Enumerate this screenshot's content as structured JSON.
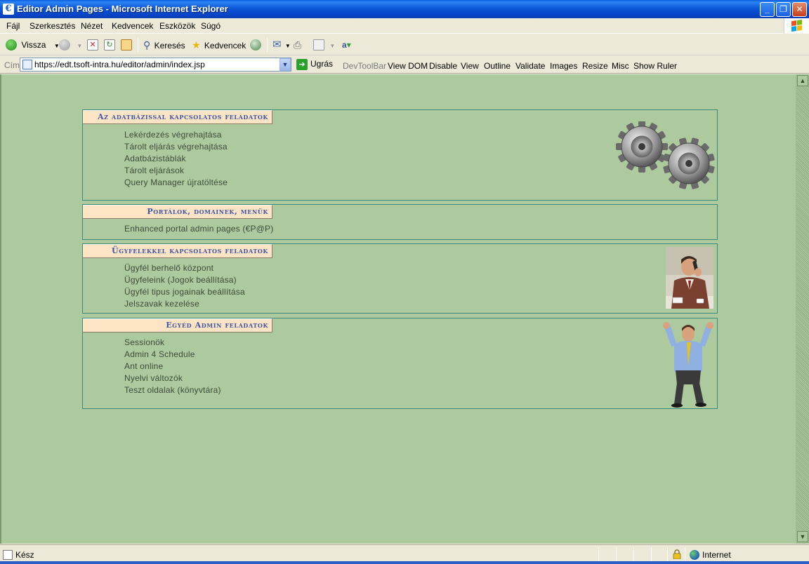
{
  "window": {
    "title": "Editor Admin Pages - Microsoft Internet Explorer",
    "app_icon_glyph": "€"
  },
  "menu": [
    "Fájl",
    "Szerkesztés",
    "Nézet",
    "Kedvencek",
    "Eszközök",
    "Súgó"
  ],
  "toolbar": {
    "back": "Vissza",
    "search": "Keresés",
    "favorites": "Kedvencek"
  },
  "address": {
    "label": "Cím",
    "url": "https://edt.tsoft-intra.hu/editor/admin/index.jsp",
    "go": "Ugrás"
  },
  "devtoolbar": [
    "DevToolBar",
    "View DOM",
    "Disable",
    "View",
    "Outline",
    "Validate",
    "Images",
    "Resize",
    "Misc",
    "Show Ruler"
  ],
  "sections": [
    {
      "header": "Az adatbázissal kapcsolatos feladatok",
      "links": [
        "Lekérdezés végrehajtása",
        "Tárolt eljárás végrehajtása",
        "Adatbázistáblák",
        "Tárolt eljárások",
        "Query Manager újratöltése"
      ],
      "image": "gears-icon"
    },
    {
      "header": "Portálok, domainek, menük",
      "links": [
        "Enhanced portal admin pages (€P@P)"
      ],
      "image": ""
    },
    {
      "header": "Ügyfelekkel kapcsolatos feladatok",
      "links": [
        "Ügyfél berhelő központ",
        "Ügyfeleink (Jogok beállítása)",
        "Ügyfél tipus jogainak beállítása",
        "Jelszavak kezelése"
      ],
      "image": "businessman-phone-photo"
    },
    {
      "header": "Egyéd Admin feladatok",
      "links": [
        "Sessionök",
        "Admin 4 Schedule",
        "Ant online",
        "Nyelvi változók",
        "Teszt oldalak (könyvtára)"
      ],
      "image": "excited-man-photo"
    }
  ],
  "status": {
    "text": "Kész",
    "zone": "Internet"
  },
  "colors": {
    "content_bg": "#adca9e",
    "header_bg": "#fde4c4",
    "header_text": "#3d56a8",
    "border": "#3f8a7a"
  }
}
